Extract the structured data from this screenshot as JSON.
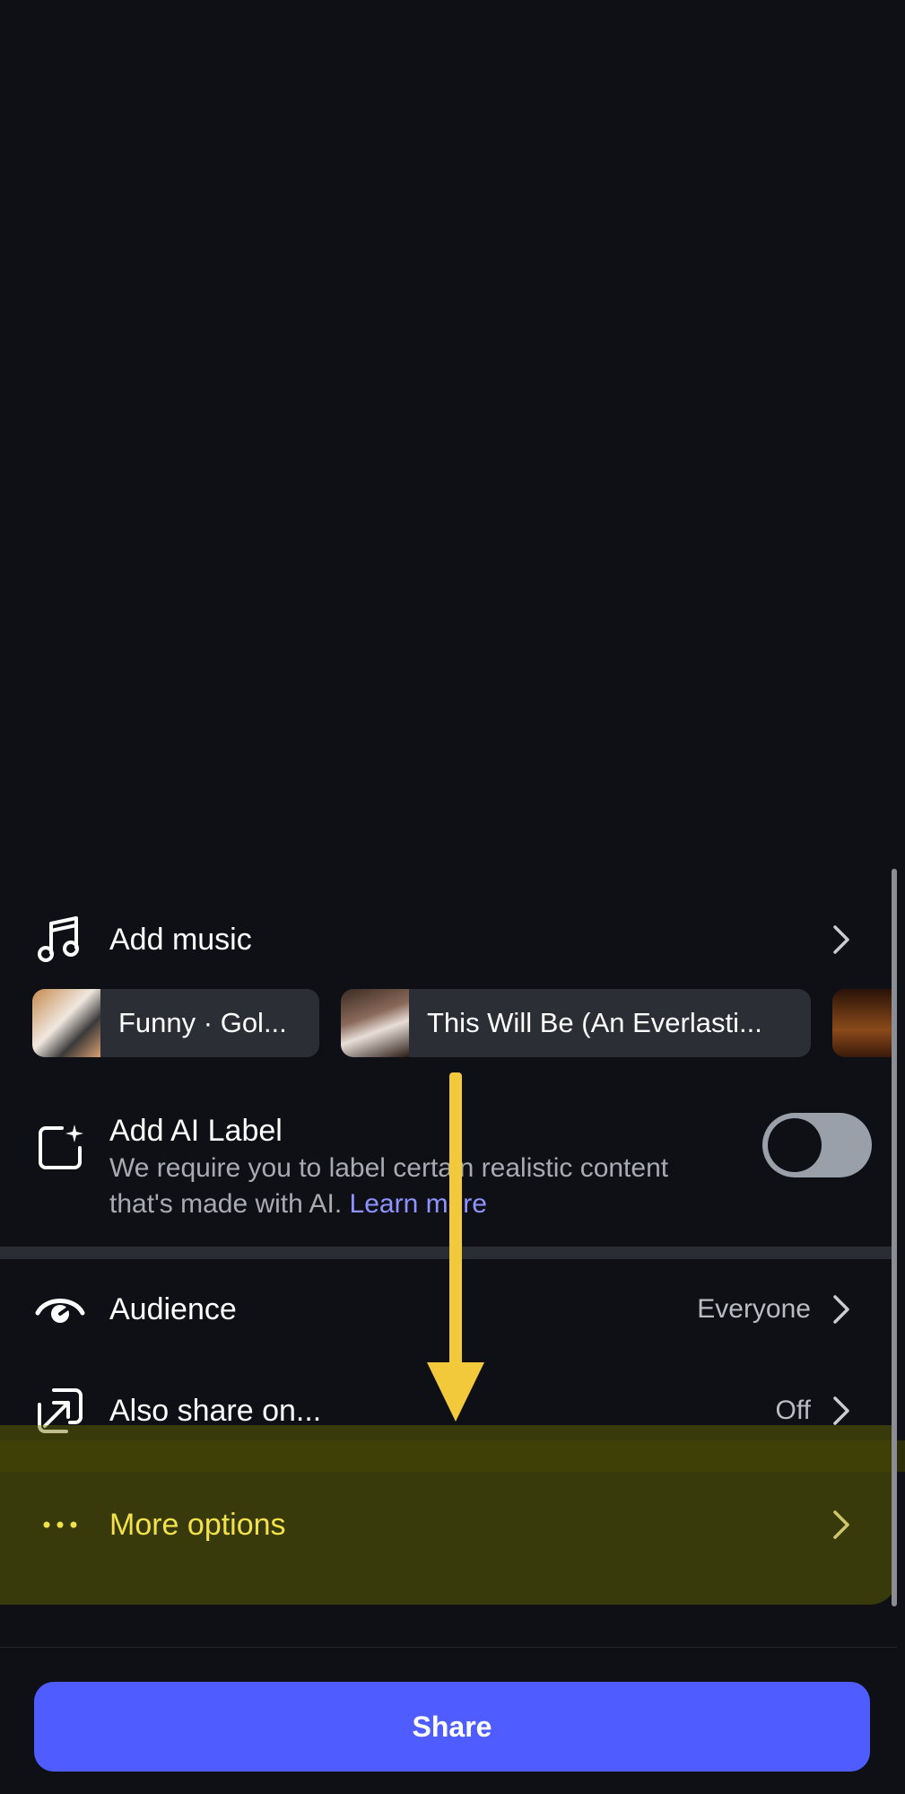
{
  "music": {
    "label": "Add music",
    "tracks": [
      {
        "title": "Funny · Gol..."
      },
      {
        "title": "This Will Be (An Everlasti..."
      }
    ]
  },
  "ai_label": {
    "title": "Add AI Label",
    "description": "We require you to label certain realistic content that's made with AI.",
    "learn_more": "Learn more",
    "toggle_on": false
  },
  "audience": {
    "label": "Audience",
    "value": "Everyone"
  },
  "also_share": {
    "label": "Also share on...",
    "value": "Off"
  },
  "more_options": {
    "label": "More options"
  },
  "share_button": {
    "label": "Share"
  },
  "colors": {
    "background": "#0e1016",
    "accent": "#4f5cff",
    "link": "#8f93ff",
    "highlight_text": "#f2e14a",
    "annotation_arrow": "#f2c93b"
  }
}
